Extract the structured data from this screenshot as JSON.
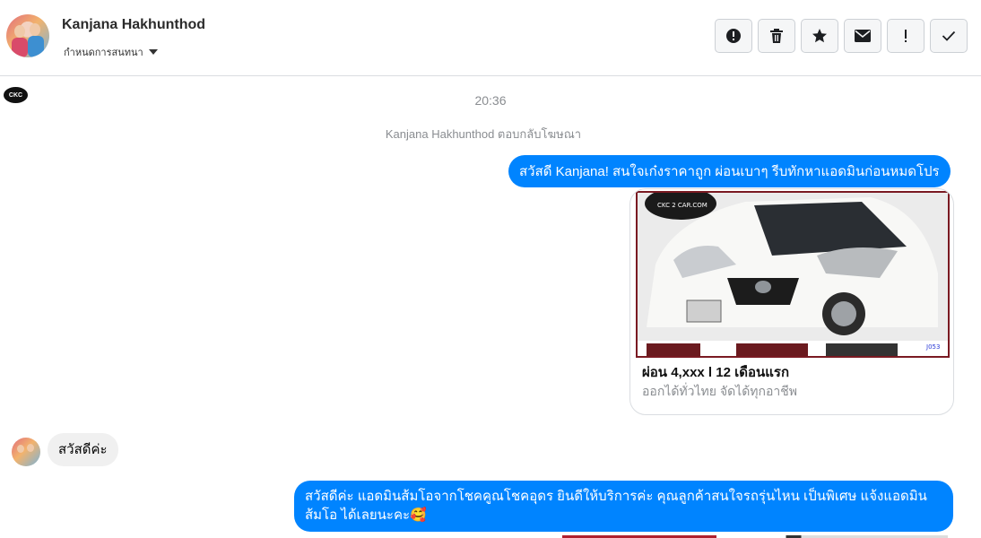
{
  "header": {
    "contact_name": "Kanjana Hakhunthod",
    "assign_label": "กำหนดการสนทนา"
  },
  "toolbar": {
    "buttons": [
      {
        "icon": "alert-circle-icon"
      },
      {
        "icon": "trash-icon"
      },
      {
        "icon": "star-icon"
      },
      {
        "icon": "envelope-icon"
      },
      {
        "icon": "exclamation-icon"
      },
      {
        "icon": "check-icon"
      }
    ]
  },
  "page_logo_text": "CKC",
  "conversation": {
    "time": "20:36",
    "system_note": "Kanjana Hakhunthod ตอบกลับโฆษณา",
    "messages": [
      {
        "from": "page",
        "text": "สวัสดี Kanjana! สนใจเก๋งราคาถูก ผ่อนเบาๆ รีบทักหาแอดมินก่อนหมดโปร"
      },
      {
        "from": "customer",
        "text": "สวัสดีค่ะ"
      },
      {
        "from": "page",
        "text": "สวัสดีค่ะ แอดมินส้มโอจากโชคคูณโชคอุดร ยินดีให้บริการค่ะ   คุณลูกค้าสนใจรถรุ่นไหน เป็นพิเศษ แจ้งแอดมินส้มโอ ได้เลยนะคะ🥰"
      }
    ],
    "ad_card": {
      "title": "ผ่อน 4,xxx l 12 เดือนแรก",
      "subtitle": "ออกได้ทั่วไทย จัดได้ทุกอาชีพ",
      "image_watermark": "CKC 2 CAR.COM",
      "image_code": "J053"
    }
  },
  "colors": {
    "outgoing_bubble": "#0084ff",
    "incoming_bubble": "#f0f0f0",
    "meta_text": "#8a8d91"
  }
}
